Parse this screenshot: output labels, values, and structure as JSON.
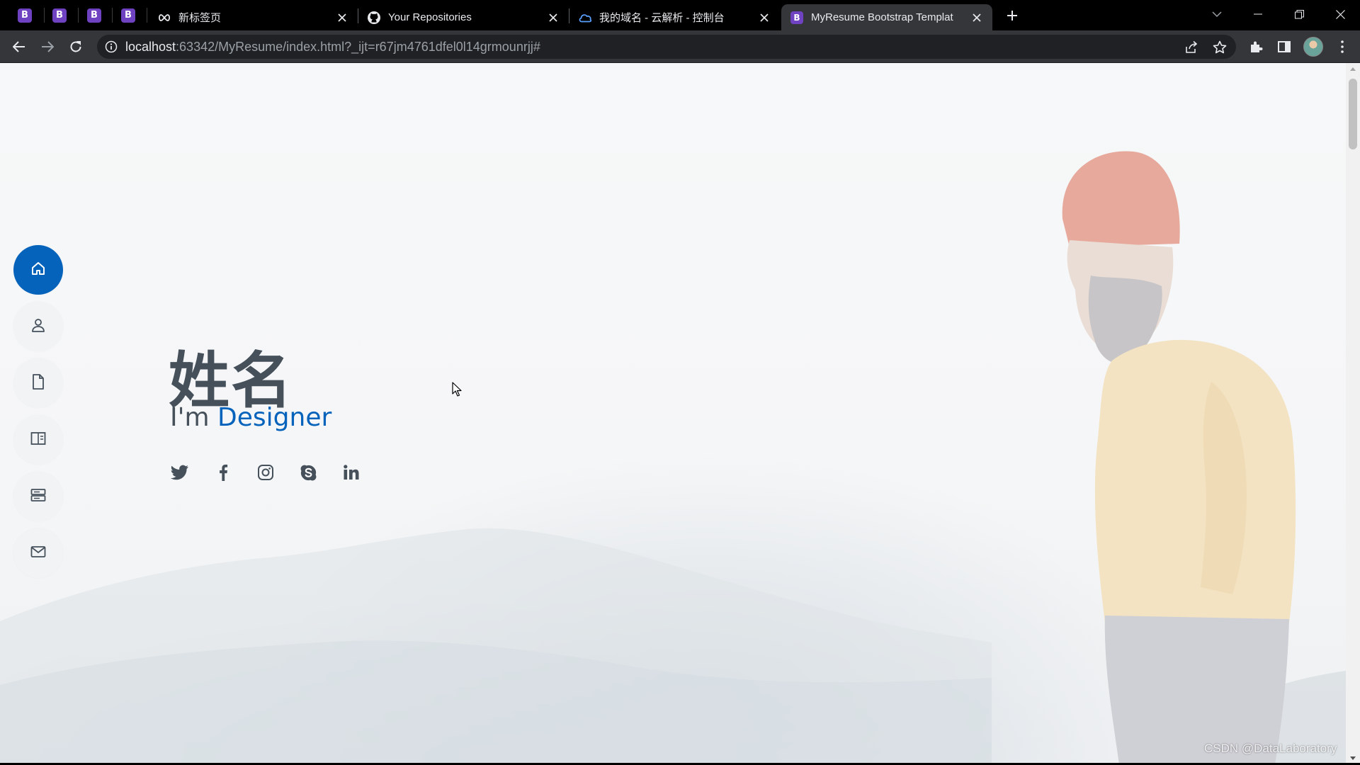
{
  "browser": {
    "pinned_tabs": [
      {
        "icon": "bootstrap-icon",
        "letter": "B"
      },
      {
        "icon": "bootstrap-icon",
        "letter": "B"
      },
      {
        "icon": "bootstrap-icon",
        "letter": "B"
      },
      {
        "icon": "bootstrap-icon",
        "letter": "B"
      }
    ],
    "tabs": [
      {
        "title": "新标签页",
        "icon": "infinity-icon"
      },
      {
        "title": "Your Repositories",
        "icon": "github-icon"
      },
      {
        "title": "我的域名 - 云解析 - 控制台",
        "icon": "cloud-icon"
      },
      {
        "title": "MyResume Bootstrap Templat",
        "icon": "bootstrap-icon",
        "letter": "B",
        "active": true
      }
    ],
    "url_host": "localhost",
    "url_rest": ":63342/MyResume/index.html?_ijt=r67jm4761dfel0l14grmounrjj#"
  },
  "page": {
    "hero": {
      "name": "姓名",
      "prefix": "I'm ",
      "role": "Designer"
    },
    "nav": [
      {
        "icon": "home-icon",
        "active": true
      },
      {
        "icon": "person-icon",
        "active": false
      },
      {
        "icon": "file-icon",
        "active": false
      },
      {
        "icon": "book-icon",
        "active": false
      },
      {
        "icon": "server-icon",
        "active": false
      },
      {
        "icon": "envelope-icon",
        "active": false
      }
    ],
    "social": [
      "twitter-icon",
      "facebook-icon",
      "instagram-icon",
      "skype-icon",
      "linkedin-icon"
    ],
    "colors": {
      "accent": "#0563bb",
      "text": "#45505b"
    }
  },
  "watermark": "CSDN @DataLaboratory"
}
